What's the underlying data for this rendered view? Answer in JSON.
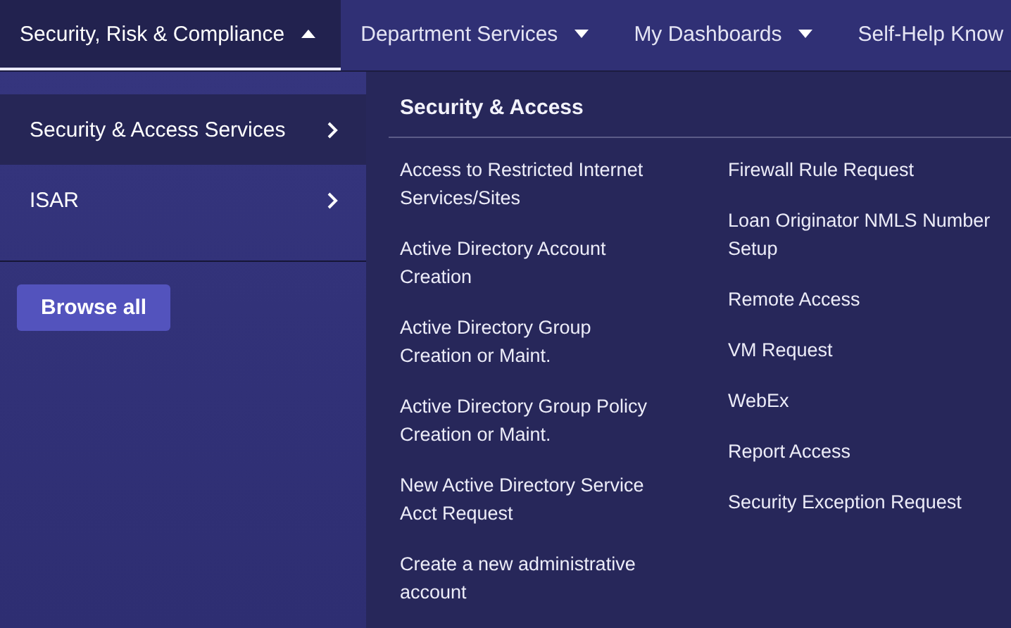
{
  "nav": {
    "items": [
      {
        "label": "Security, Risk & Compliance",
        "expanded": true
      },
      {
        "label": "Department Services",
        "expanded": false
      },
      {
        "label": "My Dashboards",
        "expanded": false
      },
      {
        "label": "Self-Help Know"
      }
    ]
  },
  "categories": [
    {
      "label": "Security & Access Services",
      "selected": true
    },
    {
      "label": "ISAR",
      "selected": false
    }
  ],
  "browse_button": "Browse all",
  "panel": {
    "title": "Security & Access",
    "columns": [
      [
        "Access to Restricted Internet Services/Sites",
        "Active Directory Account Creation",
        "Active Directory Group Creation or Maint.",
        "Active Directory Group Policy Creation or Maint.",
        "New Active Directory Service Acct Request",
        "Create a new administrative account"
      ],
      [
        "Firewall Rule Request",
        "Loan Originator NMLS Number Setup",
        "Remote Access",
        "VM Request",
        "WebEx",
        "Report Access",
        "Security Exception Request"
      ]
    ]
  }
}
